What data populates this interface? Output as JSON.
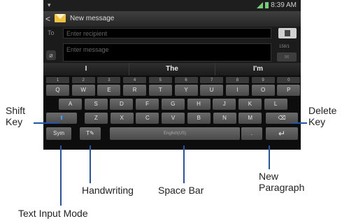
{
  "status": {
    "time": "8:39 AM"
  },
  "header": {
    "title": "New message",
    "back_icon": "chevron-left-icon",
    "app_icon": "envelope-icon"
  },
  "to_row": {
    "label": "To",
    "placeholder": "Enter recipient"
  },
  "message": {
    "placeholder": "Enter message",
    "counter": "158/1"
  },
  "suggestions": [
    "I",
    "The",
    "I'm"
  ],
  "keyboard": {
    "row1": [
      {
        "k": "Q",
        "n": "1"
      },
      {
        "k": "W",
        "n": "2"
      },
      {
        "k": "E",
        "n": "3"
      },
      {
        "k": "R",
        "n": "4"
      },
      {
        "k": "T",
        "n": "5"
      },
      {
        "k": "Y",
        "n": "6"
      },
      {
        "k": "U",
        "n": "7"
      },
      {
        "k": "I",
        "n": "8"
      },
      {
        "k": "O",
        "n": "9"
      },
      {
        "k": "P",
        "n": "0"
      }
    ],
    "row2": [
      "A",
      "S",
      "D",
      "F",
      "G",
      "H",
      "J",
      "K",
      "L"
    ],
    "row3": [
      "Z",
      "X",
      "C",
      "V",
      "B",
      "N",
      "M"
    ],
    "sym_label": "Sym",
    "space_label": "English(US)",
    "period_label": "."
  },
  "callouts": {
    "shift": [
      "Shift",
      "Key"
    ],
    "delete": [
      "Delete",
      "Key"
    ],
    "new_paragraph": [
      "New",
      "Paragraph"
    ],
    "handwriting": "Handwriting",
    "space_bar": "Space Bar",
    "text_input_mode": "Text Input Mode"
  },
  "colors": {
    "callout_line": "#2255a8",
    "shift_arrow": "#3fa2ff"
  }
}
